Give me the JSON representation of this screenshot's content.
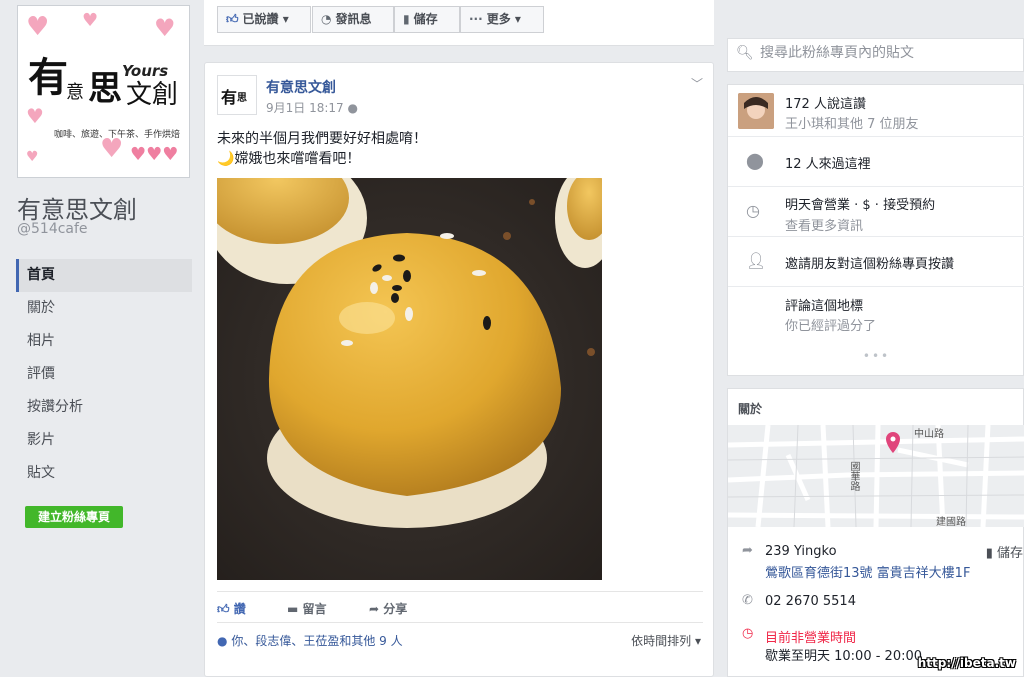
{
  "page": {
    "name": "有意思文創",
    "handle": "@514cafe",
    "logo": {
      "line1": "有",
      "line2": "意",
      "line3": "思",
      "line4": "文創",
      "yours": "Yours",
      "tagline": "咖啡、旅遊、下午茶、手作烘焙"
    }
  },
  "left_nav": [
    {
      "label": "首頁",
      "active": true
    },
    {
      "label": "關於"
    },
    {
      "label": "相片"
    },
    {
      "label": "評價"
    },
    {
      "label": "按讚分析"
    },
    {
      "label": "影片"
    },
    {
      "label": "貼文"
    }
  ],
  "create_page_button": "建立粉絲專頁",
  "action_bar": {
    "liked": "已說讚",
    "message": "發訊息",
    "save": "儲存",
    "more": "更多"
  },
  "post": {
    "author": "有意思文創",
    "timestamp": "9月1日 18:17",
    "text_line1": "未來的半個月我們要好好相處唷！",
    "text_line2": "🌙嫦娥也來嚐嚐看吧！",
    "actions": {
      "like": "讚",
      "comment": "留言",
      "share": "分享"
    },
    "likes_summary": "你、段志偉、王莅盈和其他 9 人",
    "sort": "依時間排列"
  },
  "search": {
    "placeholder": "搜尋此粉絲專頁內的貼文"
  },
  "info": {
    "likes_count": "172 人說這讚",
    "likes_friends": "王小琪和其他 7 位朋友",
    "checkins": "12 人來過這裡",
    "hours_line1": "明天會營業 · $ · 接受預約",
    "hours_line2": "查看更多資訊",
    "invite": "邀請朋友對這個粉絲專頁按讚",
    "review_line1": "評論這個地標",
    "review_line2": "你已經評過分了",
    "more": "•••"
  },
  "about": {
    "title": "關於",
    "map_labels": {
      "road1": "中山路",
      "road2": "國華路",
      "road3": "建國路"
    },
    "address_line1": "239 Yingko",
    "address_line2": "鶯歌區育德街13號 富貴吉祥大樓1F",
    "save_label": "儲存",
    "phone": "02 2670 5514",
    "status": "目前非營業時間",
    "hours": "歇業至明天 10:00 - 20:00"
  },
  "watermark": "http://ibeta.tw",
  "colors": {
    "fb_blue": "#4267b2",
    "link": "#365899",
    "green": "#42b72a",
    "red": "#f02849",
    "pin": "#e0457b"
  }
}
